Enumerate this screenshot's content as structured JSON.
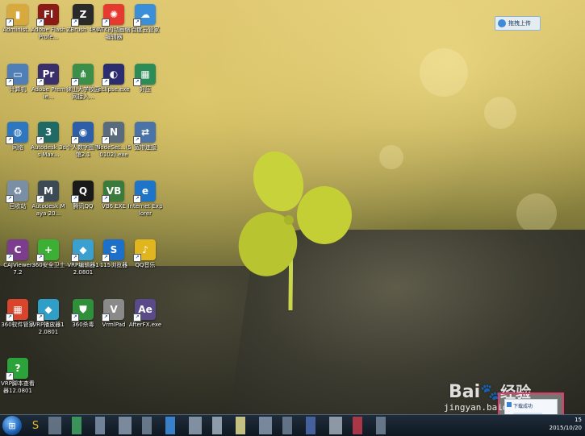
{
  "desktop_icons": [
    {
      "label": "Administ...",
      "icon": "user-folder-icon",
      "color": "#d8a93c",
      "glyph": "▮"
    },
    {
      "label": "Adobe Flash Profe...",
      "icon": "flash-icon",
      "color": "#8a1b16",
      "glyph": "Fl"
    },
    {
      "label": "ZBrush 4R6",
      "icon": "zbrush-icon",
      "color": "#2a2a2a",
      "glyph": "Z"
    },
    {
      "label": "ATK的动画缩编辑器",
      "icon": "pinwheel-icon",
      "color": "#e43a2f",
      "glyph": "✺"
    },
    {
      "label": "百度云管家",
      "icon": "baidu-cloud-icon",
      "color": "#3b8fd9",
      "glyph": "☁"
    },
    {
      "label": "计算机",
      "icon": "computer-icon",
      "color": "#4f7fb6",
      "glyph": "▭"
    },
    {
      "label": "Adobe Premie...",
      "icon": "premiere-icon",
      "color": "#3a2f6a",
      "glyph": "Pr"
    },
    {
      "label": "徕山大学校园网接入...",
      "icon": "network-client-icon",
      "color": "#3c8f4a",
      "glyph": "⋔"
    },
    {
      "label": "eclipse.exe",
      "icon": "eclipse-icon",
      "color": "#2b2d6e",
      "glyph": "◐"
    },
    {
      "label": "好压",
      "icon": "haozip-icon",
      "color": "#2c8c58",
      "glyph": "▦"
    },
    {
      "label": "网络",
      "icon": "network-icon",
      "color": "#2c77c0",
      "glyph": "◍"
    },
    {
      "label": "Autodesk 3ds Max...",
      "icon": "3dsmax-icon",
      "color": "#1f6a66",
      "glyph": "3"
    },
    {
      "label": "个人数字图书馆2.1",
      "icon": "digital-library-icon",
      "color": "#2d5fa8",
      "glyph": "◉"
    },
    {
      "label": "NodeSet...(50102).exe",
      "icon": "nodeset-icon",
      "color": "#5a6b7d",
      "glyph": "N"
    },
    {
      "label": "宽带连接",
      "icon": "broadband-icon",
      "color": "#4a74a8",
      "glyph": "⇄"
    },
    {
      "label": "回收站",
      "icon": "recycle-bin-icon",
      "color": "#7a8ea5",
      "glyph": "♻"
    },
    {
      "label": "Autodesk Maya 20...",
      "icon": "maya-icon",
      "color": "#3c4a56",
      "glyph": "M"
    },
    {
      "label": "腾讯QQ",
      "icon": "qq-icon",
      "color": "#1a1a1a",
      "glyph": "Q"
    },
    {
      "label": "VB6.EXE",
      "icon": "vb6-icon",
      "color": "#3a7a3a",
      "glyph": "VB"
    },
    {
      "label": "Internet Explorer",
      "icon": "ie-icon",
      "color": "#1e74c8",
      "glyph": "e"
    },
    {
      "label": "CAJViewer 7.2",
      "icon": "cajviewer-icon",
      "color": "#7d3d8f",
      "glyph": "C"
    },
    {
      "label": "360安全卫士",
      "icon": "360-safe-icon",
      "color": "#3bb034",
      "glyph": "+"
    },
    {
      "label": "VRP编辑器12.0801",
      "icon": "vrp-editor-icon",
      "color": "#3aa0d0",
      "glyph": "◆"
    },
    {
      "label": "115浏览器",
      "icon": "115-browser-icon",
      "color": "#1d70c9",
      "glyph": "S"
    },
    {
      "label": "QQ音乐",
      "icon": "qq-music-icon",
      "color": "#e0b51e",
      "glyph": "♪"
    },
    {
      "label": "360软件管家",
      "icon": "360-software-icon",
      "color": "#d8452c",
      "glyph": "▦"
    },
    {
      "label": "VRP播放器12.0801",
      "icon": "vrp-player-icon",
      "color": "#2f9fc7",
      "glyph": "◆"
    },
    {
      "label": "360杀毒",
      "icon": "360-antivirus-icon",
      "color": "#2f8f3a",
      "glyph": "⛊"
    },
    {
      "label": "VrmlPad",
      "icon": "vrmlpad-icon",
      "color": "#8a8a8a",
      "glyph": "V"
    },
    {
      "label": "AfterFX.exe",
      "icon": "afterfx-icon",
      "color": "#5a4a8a",
      "glyph": "Ae"
    },
    {
      "label": "VRP脚本查看器12.0801",
      "icon": "vrp-script-icon",
      "color": "#2ca33a",
      "glyph": "?"
    }
  ],
  "cloud_upload": {
    "label": "拖拽上传"
  },
  "watermark": {
    "brand": "Bai",
    "paw": "🐾",
    "brand_tail": "经验",
    "url": "jingyan.baidu.com"
  },
  "notification": {
    "title": "下载成功"
  },
  "taskbar": {
    "items_colors": [
      "#6a7a8c",
      "#3fa060",
      "#7a8da3",
      "#8595a8",
      "#6f8194",
      "#3d8bd8",
      "#8d9cad",
      "#9aa8b8",
      "#d7d28b",
      "#8294a8",
      "#6a7c90",
      "#4a68a8",
      "#9aa5b3",
      "#b83a4a",
      "#6f7f92"
    ],
    "clock_time": "15",
    "clock_date": "2015/10/20"
  },
  "colors": {
    "highlight": "#e23a6e"
  }
}
